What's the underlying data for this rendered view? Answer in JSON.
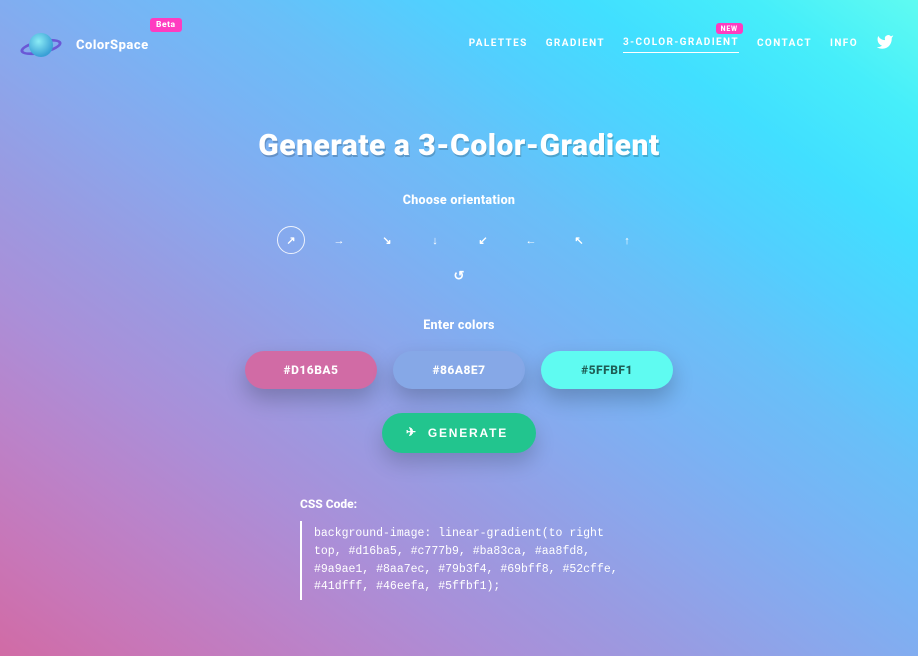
{
  "brand": {
    "name": "ColorSpace",
    "badge": "Beta"
  },
  "nav": {
    "items": [
      {
        "label": "PALETTES"
      },
      {
        "label": "GRADIENT"
      },
      {
        "label": "3-COLOR-GRADIENT",
        "active": true,
        "badge": "NEW"
      },
      {
        "label": "CONTACT"
      },
      {
        "label": "INFO"
      }
    ]
  },
  "main": {
    "title": "Generate a 3-Color-Gradient",
    "orientation_label": "Choose orientation",
    "orientations": [
      {
        "name": "right-top",
        "glyph": "↗",
        "selected": true
      },
      {
        "name": "right",
        "glyph": "→"
      },
      {
        "name": "right-bottom",
        "glyph": "↘"
      },
      {
        "name": "bottom",
        "glyph": "↓"
      },
      {
        "name": "left-bottom",
        "glyph": "↙"
      },
      {
        "name": "left",
        "glyph": "←"
      },
      {
        "name": "left-top",
        "glyph": "↖"
      },
      {
        "name": "top",
        "glyph": "↑"
      }
    ],
    "reset": {
      "glyph": "↺"
    },
    "colors_label": "Enter colors",
    "colors": [
      {
        "hex": "#D16BA5",
        "bg": "#d16ba5",
        "text": "light"
      },
      {
        "hex": "#86A8E7",
        "bg": "#86a8e7",
        "text": "light"
      },
      {
        "hex": "#5FFBF1",
        "bg": "#5ffbf1",
        "text": "dark"
      }
    ],
    "generate_label": "GENERATE",
    "css_label": "CSS Code:",
    "css_code": "background-image: linear-gradient(to right top, #d16ba5, #c777b9, #ba83ca, #aa8fd8, #9a9ae1, #8aa7ec, #79b3f4, #69bff8, #52cffe, #41dfff, #46eefa, #5ffbf1);"
  }
}
